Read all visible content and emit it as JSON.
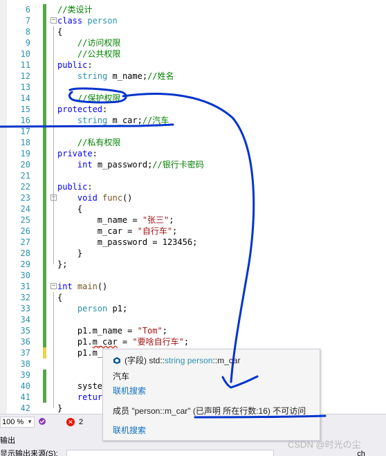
{
  "editor": {
    "lines": [
      {
        "n": "6",
        "tokens": [
          {
            "t": "//类设计",
            "c": "c"
          }
        ]
      },
      {
        "n": "7",
        "tokens": [
          {
            "t": "class",
            "c": "k"
          },
          {
            "t": " "
          },
          {
            "t": "person",
            "c": "t"
          }
        ]
      },
      {
        "n": "8",
        "tokens": [
          {
            "t": "{"
          }
        ]
      },
      {
        "n": "9",
        "tokens": [
          {
            "t": "    "
          },
          {
            "t": "//访问权限",
            "c": "c"
          }
        ]
      },
      {
        "n": "10",
        "tokens": [
          {
            "t": "    "
          },
          {
            "t": "//公共权限",
            "c": "c"
          }
        ]
      },
      {
        "n": "11",
        "tokens": [
          {
            "t": "public",
            "c": "k"
          },
          {
            "t": ":"
          }
        ]
      },
      {
        "n": "12",
        "tokens": [
          {
            "t": "    "
          },
          {
            "t": "string",
            "c": "t"
          },
          {
            "t": " m_name;"
          },
          {
            "t": "//姓名",
            "c": "c"
          }
        ]
      },
      {
        "n": "13",
        "tokens": []
      },
      {
        "n": "14",
        "tokens": [
          {
            "t": "    "
          },
          {
            "t": "//保护权限",
            "c": "c"
          }
        ]
      },
      {
        "n": "15",
        "tokens": [
          {
            "t": "protected",
            "c": "k"
          },
          {
            "t": ":"
          }
        ]
      },
      {
        "n": "16",
        "tokens": [
          {
            "t": "    "
          },
          {
            "t": "string",
            "c": "t"
          },
          {
            "t": " m_car;"
          },
          {
            "t": "//汽车",
            "c": "c"
          }
        ]
      },
      {
        "n": "17",
        "tokens": []
      },
      {
        "n": "18",
        "tokens": [
          {
            "t": "    "
          },
          {
            "t": "//私有权限",
            "c": "c"
          }
        ]
      },
      {
        "n": "19",
        "tokens": [
          {
            "t": "private",
            "c": "k"
          },
          {
            "t": ":"
          }
        ]
      },
      {
        "n": "20",
        "tokens": [
          {
            "t": "    "
          },
          {
            "t": "int",
            "c": "k"
          },
          {
            "t": " m_password;"
          },
          {
            "t": "//银行卡密码",
            "c": "c"
          }
        ]
      },
      {
        "n": "21",
        "tokens": []
      },
      {
        "n": "22",
        "tokens": [
          {
            "t": "public",
            "c": "k"
          },
          {
            "t": ":"
          }
        ]
      },
      {
        "n": "23",
        "tokens": [
          {
            "t": "    "
          },
          {
            "t": "void",
            "c": "k"
          },
          {
            "t": " "
          },
          {
            "t": "func",
            "c": "f"
          },
          {
            "t": "()"
          }
        ]
      },
      {
        "n": "24",
        "tokens": [
          {
            "t": "    {"
          }
        ]
      },
      {
        "n": "25",
        "tokens": [
          {
            "t": "        m_name = "
          },
          {
            "t": "\"张三\"",
            "c": "s"
          },
          {
            "t": ";"
          }
        ]
      },
      {
        "n": "26",
        "tokens": [
          {
            "t": "        m_car = "
          },
          {
            "t": "\"自行车\"",
            "c": "s"
          },
          {
            "t": ";"
          }
        ]
      },
      {
        "n": "27",
        "tokens": [
          {
            "t": "        m_password = 123456;"
          }
        ]
      },
      {
        "n": "28",
        "tokens": [
          {
            "t": "    }"
          }
        ]
      },
      {
        "n": "29",
        "tokens": [
          {
            "t": "};"
          }
        ]
      },
      {
        "n": "30",
        "tokens": []
      },
      {
        "n": "31",
        "tokens": [
          {
            "t": "int",
            "c": "k"
          },
          {
            "t": " "
          },
          {
            "t": "main",
            "c": "f"
          },
          {
            "t": "()"
          }
        ]
      },
      {
        "n": "32",
        "tokens": [
          {
            "t": "{"
          }
        ]
      },
      {
        "n": "33",
        "tokens": [
          {
            "t": "    "
          },
          {
            "t": "person",
            "c": "t"
          },
          {
            "t": " p1;"
          }
        ]
      },
      {
        "n": "34",
        "tokens": []
      },
      {
        "n": "35",
        "tokens": [
          {
            "t": "    p1.m_name = "
          },
          {
            "t": "\"Tom\"",
            "c": "s"
          },
          {
            "t": ";"
          }
        ]
      },
      {
        "n": "36",
        "tokens": [
          {
            "t": "    p1."
          },
          {
            "t": "m_car",
            "c": "sq"
          },
          {
            "t": " = "
          },
          {
            "t": "\"要啥自行车\"",
            "c": "s"
          },
          {
            "t": ";"
          }
        ]
      },
      {
        "n": "37",
        "tokens": [
          {
            "t": "    p1.m_p"
          }
        ]
      },
      {
        "n": "38",
        "tokens": []
      },
      {
        "n": "39",
        "tokens": []
      },
      {
        "n": "40",
        "tokens": [
          {
            "t": "    system"
          }
        ]
      },
      {
        "n": "41",
        "tokens": [
          {
            "t": "    "
          },
          {
            "t": "retur",
            "c": "k"
          }
        ]
      },
      {
        "n": "42",
        "tokens": [
          {
            "t": "}"
          }
        ]
      }
    ]
  },
  "tooltip": {
    "kind_label": "(字段)",
    "sig_ns": "std::",
    "sig_type": "string",
    "sig_class": "person",
    "sig_sep": "::",
    "sig_member": "m_car",
    "description": "汽车",
    "search_link_1": "联机搜索",
    "message": "成员 \"person::m_car\" (已声明 所在行数:16) 不可访问",
    "search_link_2": "联机搜索"
  },
  "status": {
    "zoom": "100 %",
    "error_count": "2"
  },
  "output": {
    "title": "输出",
    "source_label": "显示输出来源(S):",
    "button_label": "ch"
  },
  "watermark": "CSDN @时光の尘",
  "colors": {
    "keyword": "#0000ff",
    "type": "#2b91af",
    "comment": "#008000",
    "string": "#a31515",
    "line_number": "#2b91af",
    "link": "#0e70c0",
    "ink": "#0033cc",
    "change_bar": "#57a64a"
  },
  "icons": {
    "field": "field-icon",
    "health": "health-icon",
    "error": "error-icon"
  }
}
